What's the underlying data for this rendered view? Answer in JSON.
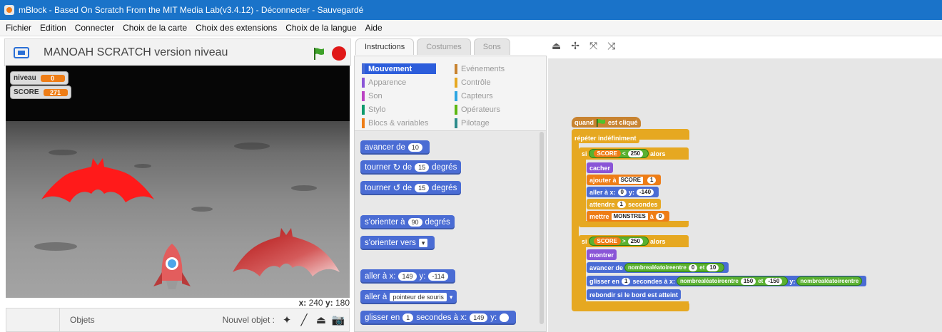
{
  "window": {
    "title": "mBlock - Based On Scratch From the MIT Media Lab(v3.4.12) - Déconnecter - Sauvegardé"
  },
  "menu": [
    "Fichier",
    "Edition",
    "Connecter",
    "Choix de la carte",
    "Choix des extensions",
    "Choix de la langue",
    "Aide"
  ],
  "stage": {
    "project_title": "MANOAH SCRATCH version niveau",
    "variables": [
      {
        "name": "niveau",
        "value": "0"
      },
      {
        "name": "SCORE",
        "value": "271"
      }
    ],
    "coords": {
      "x_label": "x:",
      "x": "240",
      "y_label": "y:",
      "y": "180"
    }
  },
  "sprites": {
    "label": "Objets",
    "new_sprite": "Nouvel objet :"
  },
  "tabs": [
    "Instructions",
    "Costumes",
    "Sons"
  ],
  "categories": [
    {
      "label": "Mouvement",
      "color": "#4a6cd4"
    },
    {
      "label": "Evénements",
      "color": "#c88330"
    },
    {
      "label": "Apparence",
      "color": "#8a55d7"
    },
    {
      "label": "Contrôle",
      "color": "#e6a821"
    },
    {
      "label": "Son",
      "color": "#bb42c3"
    },
    {
      "label": "Capteurs",
      "color": "#2ca5e2"
    },
    {
      "label": "Stylo",
      "color": "#0e9a6c"
    },
    {
      "label": "Opérateurs",
      "color": "#5cb712"
    },
    {
      "label": "Blocs & variables",
      "color": "#ee7d16"
    },
    {
      "label": "Pilotage",
      "color": "#2e8c8c"
    }
  ],
  "palette": {
    "move": {
      "text": "avancer de",
      "value": "10"
    },
    "turn_cw": {
      "text": "tourner",
      "text2": "de",
      "value": "15",
      "text3": "degrés"
    },
    "turn_ccw": {
      "text": "tourner",
      "text2": "de",
      "value": "15",
      "text3": "degrés"
    },
    "point_dir": {
      "text": "s'orienter à",
      "value": "90",
      "text2": "degrés"
    },
    "point_towards": {
      "text": "s'orienter vers"
    },
    "goto_xy": {
      "text": "aller à x:",
      "x": "149",
      "y_label": "y:",
      "y": "-114"
    },
    "goto": {
      "text": "aller à",
      "value": "pointeur de souris"
    },
    "glide": {
      "text": "glisser en",
      "secs": "1",
      "text2": "secondes à x:",
      "x": "149",
      "y_label": "y:"
    }
  },
  "script": {
    "hat": {
      "text1": "quand",
      "text2": "est cliqué"
    },
    "forever": "répéter indéfiniment",
    "if1": {
      "si": "si",
      "var": "SCORE",
      "op": "<",
      "value": "250",
      "alors": "alors"
    },
    "hide": "cacher",
    "change": {
      "text": "ajouter à",
      "var": "SCORE",
      "value": "1"
    },
    "goto": {
      "text": "aller à x:",
      "x": "0",
      "y_label": "y:",
      "y": "-140"
    },
    "wait": {
      "text": "attendre",
      "value": "1",
      "text2": "secondes"
    },
    "set": {
      "text": "mettre",
      "var": "MONSTRES",
      "text2": "à",
      "value": "0"
    },
    "if2": {
      "si": "si",
      "var": "SCORE",
      "op": ">",
      "value": "250",
      "alors": "alors"
    },
    "show": "montrer",
    "move": {
      "text": "avancer de",
      "pill": "nombrealéatoireentre",
      "a": "0",
      "et": "et",
      "b": "10"
    },
    "glide": {
      "text": "glisser en",
      "secs": "1",
      "text2": "secondes à x:",
      "pill": "nombrealéatoireentre",
      "a": "150",
      "et": "et",
      "b": "-150",
      "y_label": "y:",
      "pill2": "nombrealéatoireentre"
    },
    "bounce": "rebondir si le bord est atteint"
  }
}
